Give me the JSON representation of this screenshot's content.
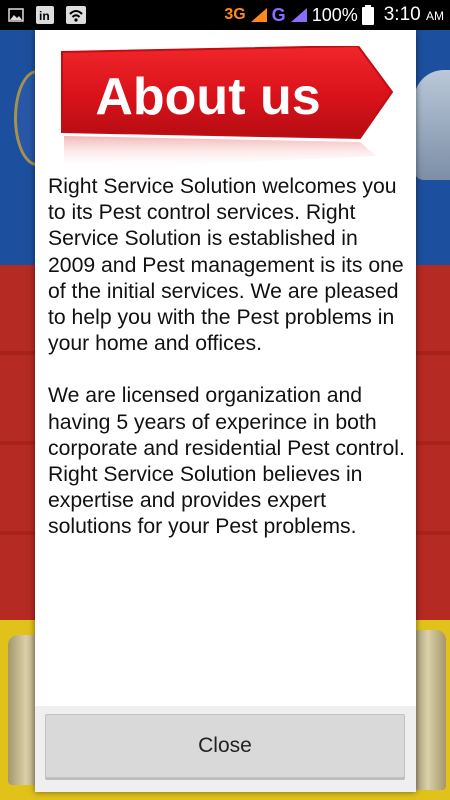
{
  "status_bar": {
    "network_3g": "3G",
    "network_g": "G",
    "battery_percent": "100%",
    "time": "3:10",
    "time_suffix": "AM",
    "icons": [
      "gallery-icon",
      "linkedin-icon",
      "wifi-icon",
      "signal-icon",
      "battery-icon"
    ]
  },
  "dialog": {
    "banner_text": "About us",
    "paragraphs": [
      "Right Service Solution welcomes you to its Pest control services. Right Service Solution is established in 2009 and Pest management is its one of the initial services. We are pleased to help you with the Pest problems in your home and offices.",
      "We are licensed organization and having 5 years of experince in both corporate and residential Pest control. Right Service Solution believes in expertise and provides expert solutions for your Pest problems."
    ],
    "close_label": "Close"
  },
  "colors": {
    "banner_red": "#e0141b",
    "background_blue": "#1c4f9e",
    "background_red": "#b52a22",
    "background_yellow": "#e0c21a"
  }
}
